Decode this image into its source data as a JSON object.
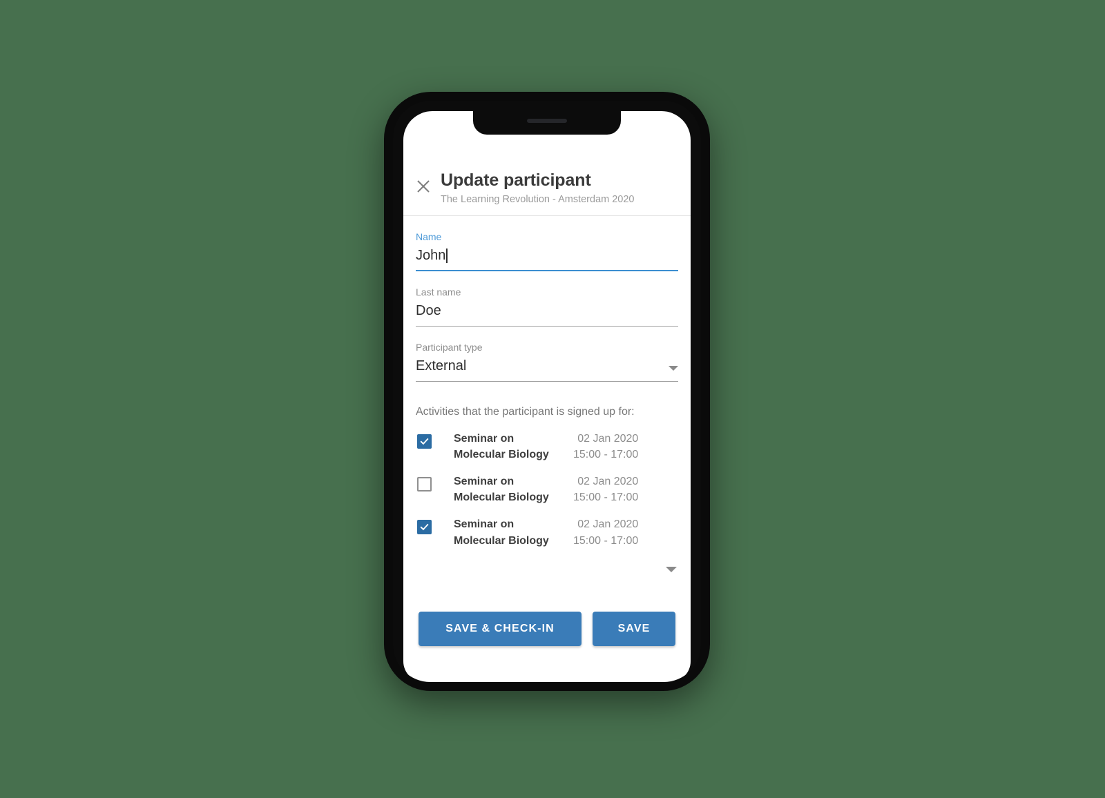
{
  "background_color": "#47704e",
  "theme": {
    "accent_blue": "#3a7cb8",
    "focus_blue": "#3b8ed0",
    "label_blue": "#4d9ad8",
    "checkbox_blue": "#2b6ca3"
  },
  "device": {
    "name": "smartphone-mockup",
    "notch": "speaker-grille"
  },
  "header": {
    "close_icon": "close-icon",
    "title": "Update participant",
    "subtitle": "The Learning Revolution - Amsterdam 2020"
  },
  "form": {
    "fields": [
      {
        "name": "name",
        "label": "Name",
        "value": "John",
        "focused": true,
        "has_caret": true,
        "type": "text"
      },
      {
        "name": "last-name",
        "label": "Last name",
        "value": "Doe",
        "focused": false,
        "has_caret": false,
        "type": "text"
      },
      {
        "name": "participant-type",
        "label": "Participant type",
        "value": "External",
        "focused": false,
        "has_caret": false,
        "type": "select",
        "arrow_icon": "chevron-down-icon"
      }
    ]
  },
  "activities": {
    "label": "Activities that the participant is signed up for:",
    "expand_icon": "expand-more-icon",
    "items": [
      {
        "checked": true,
        "title": "Seminar on Molecular Biology",
        "date": "02 Jan 2020",
        "time": "15:00 - 17:00"
      },
      {
        "checked": false,
        "title": "Seminar on Molecular Biology",
        "date": "02 Jan 2020",
        "time": "15:00 - 17:00"
      },
      {
        "checked": true,
        "title": "Seminar on Molecular Biology",
        "date": "02 Jan 2020",
        "time": "15:00 - 17:00"
      }
    ]
  },
  "actions": {
    "save_check_in_label": "SAVE & CHECK-IN",
    "save_label": "SAVE"
  }
}
